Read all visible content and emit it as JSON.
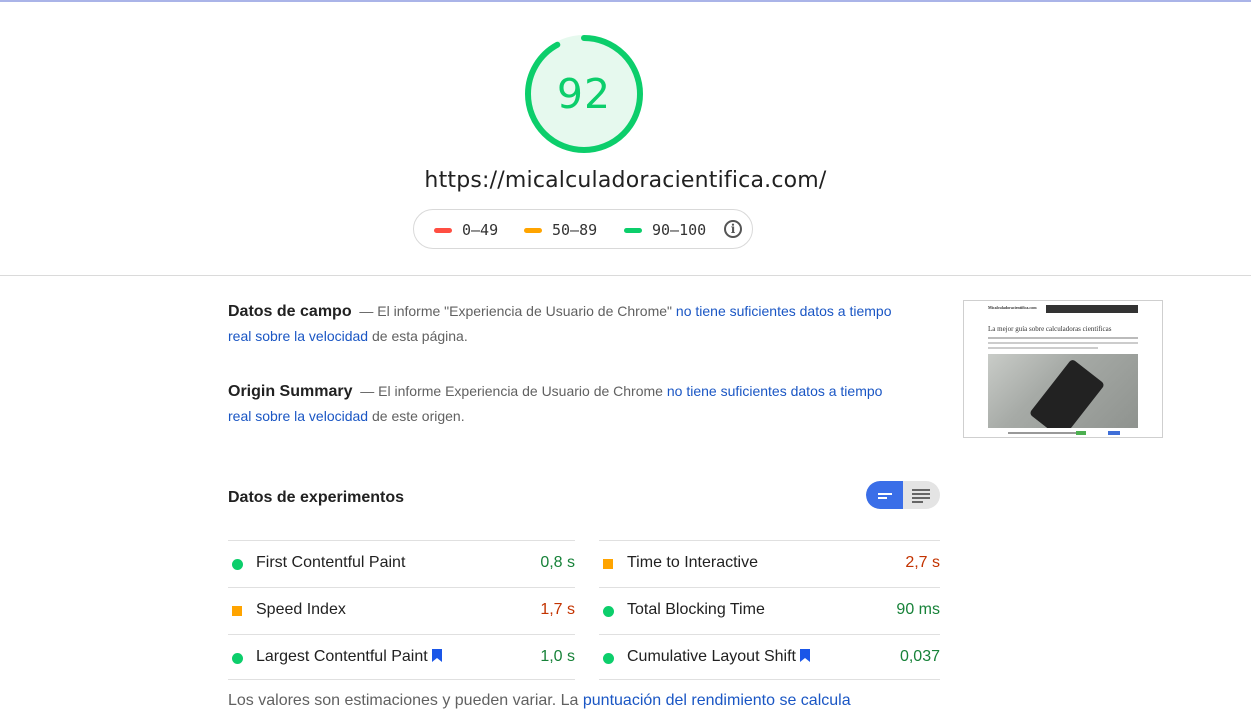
{
  "score": {
    "value": "92",
    "fraction": 0.92,
    "color": "#0cce6b",
    "track_color": "#e6f9ee"
  },
  "url": "https://micalculadoracientifica.com/",
  "legend": [
    {
      "range": "0–49",
      "color": "#ff4e42"
    },
    {
      "range": "50–89",
      "color": "#ffa400"
    },
    {
      "range": "90–100",
      "color": "#0cce6b"
    }
  ],
  "field_data": {
    "title": "Datos de campo",
    "dash": "—",
    "text_before": "El informe \"Experiencia de Usuario de Chrome\"",
    "link": "no tiene suficientes datos a tiempo real sobre la velocidad",
    "text_after": "de esta página."
  },
  "origin_summary": {
    "title": "Origin Summary",
    "dash": "—",
    "text_before": "El informe Experiencia de Usuario de Chrome",
    "link": "no tiene suficientes datos a tiempo real sobre la velocidad",
    "text_after": "de este origen."
  },
  "lab_data": {
    "title": "Datos de experimentos",
    "metrics": [
      {
        "name": "First Contentful Paint",
        "value": "0,8 s",
        "status": "pass",
        "bookmark": false
      },
      {
        "name": "Time to Interactive",
        "value": "2,7 s",
        "status": "average",
        "bookmark": false
      },
      {
        "name": "Speed Index",
        "value": "1,7 s",
        "status": "average",
        "bookmark": false
      },
      {
        "name": "Total Blocking Time",
        "value": "90 ms",
        "status": "pass",
        "bookmark": false
      },
      {
        "name": "Largest Contentful Paint",
        "value": "1,0 s",
        "status": "pass",
        "bookmark": true
      },
      {
        "name": "Cumulative Layout Shift",
        "value": "0,037",
        "status": "pass",
        "bookmark": true
      }
    ]
  },
  "footer": {
    "text": "Los valores son estimaciones y pueden variar. La",
    "link": "puntuación del rendimiento se calcula"
  },
  "thumbnail": {
    "site_name": "Micalculadoracientifica.com",
    "heading": "La mejor guía sobre calculadoras científicas"
  }
}
